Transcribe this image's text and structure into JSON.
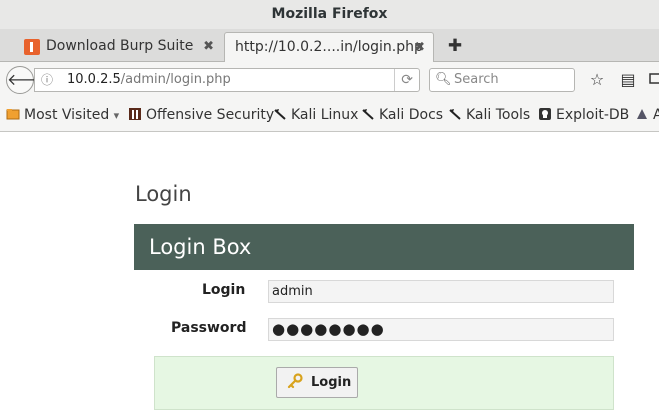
{
  "window": {
    "title": "Mozilla Firefox"
  },
  "tabs": [
    {
      "label": "Download Burp Suite ...",
      "close": "✖",
      "favicon": "burp-suite-favicon"
    },
    {
      "label": "http://10.0.2....in/login.php",
      "close": "✖"
    }
  ],
  "new_tab": "✚",
  "navigation": {
    "back": "🡐",
    "info": "ⓘ",
    "url_host": "10.0.2.5",
    "url_path": "/admin/login.php",
    "reload": "⟳",
    "search_icon": "🔍︎",
    "search_placeholder": "Search",
    "bookmark_star": "☆",
    "reading_list": "▤"
  },
  "bookmarks": [
    {
      "label": "Most Visited",
      "suffix": "▾",
      "icon": "folder-icon"
    },
    {
      "label": "Offensive Security",
      "icon": "offsec-icon"
    },
    {
      "label": "Kali Linux",
      "icon": "kali-dragon-icon"
    },
    {
      "label": "Kali Docs",
      "icon": "kali-dragon-icon"
    },
    {
      "label": "Kali Tools",
      "icon": "kali-dragon-icon"
    },
    {
      "label": "Exploit-DB",
      "icon": "exploit-db-icon"
    },
    {
      "label": "A",
      "icon": "aircrack-icon"
    }
  ],
  "page": {
    "heading": "Login",
    "box_title": "Login Box",
    "login_label": "Login",
    "login_value": "admin",
    "password_label": "Password",
    "password_value": "●●●●●●●●",
    "submit_label": "Login",
    "submit_icon": "key-icon"
  },
  "colors": {
    "box_header": "#4b6159",
    "actions_bg": "#e6f7e3",
    "burp_orange": "#e8622c"
  }
}
